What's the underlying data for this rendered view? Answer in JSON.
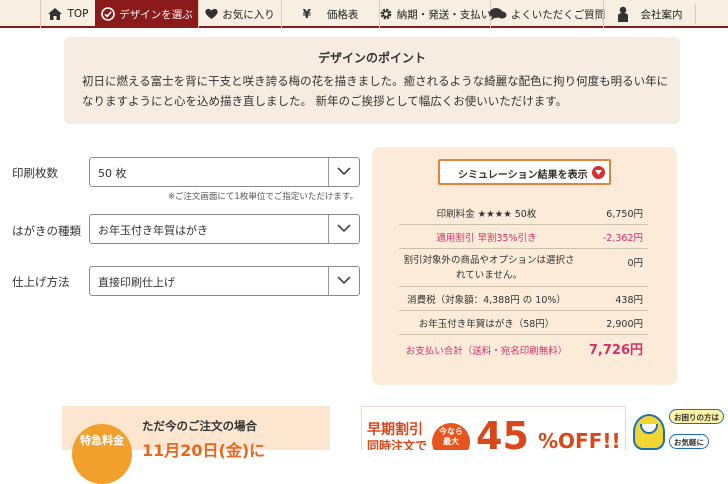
{
  "nav": {
    "items": [
      {
        "label": "TOP",
        "icon": "home-icon",
        "active": false
      },
      {
        "label": "デザインを選ぶ",
        "icon": "check-circle-icon",
        "active": true
      },
      {
        "label": "お気に入り",
        "icon": "heart-icon",
        "active": false
      },
      {
        "label": "価格表",
        "icon": "yen-icon",
        "active": false
      },
      {
        "label": "納期・発送・支払い",
        "icon": "gear-icon",
        "active": false
      },
      {
        "label": "よくいただくご質問",
        "icon": "speech-bubbles-icon",
        "active": false
      },
      {
        "label": "会社案内",
        "icon": "person-icon",
        "active": false
      }
    ],
    "accent_color": "#8b1a1a"
  },
  "design_point": {
    "title": "デザインのポイント",
    "text": "初日に燃える富士を背に干支と咲き誇る梅の花を描きました。癒されるような綺麗な配色に拘り何度も明るい年になりますようにと心を込め描き直しました。 新年のご挨拶として幅広くお使いいただけます。"
  },
  "form": {
    "print_count": {
      "label": "印刷枚数",
      "value": "50 枚"
    },
    "note": "※ご注文画面にて1枚単位でご指定いただけます。",
    "card_type": {
      "label": "はがきの種類",
      "value": "お年玉付き年賀はがき"
    },
    "finish": {
      "label": "仕上げ方法",
      "value": "直接印刷仕上げ"
    }
  },
  "simulation": {
    "button_label": "シミュレーション結果を表示",
    "rows": [
      {
        "label": "印刷料金 ★★★★ 50枚",
        "value": "6,750円"
      },
      {
        "label": "適用割引 早割35%引き",
        "value": "-2,362円"
      },
      {
        "label": "割引対象外の商品やオプションは選択されていません。",
        "value": "0円"
      },
      {
        "label": "消費税（対象額：4,388円 の 10%）",
        "value": "438円"
      },
      {
        "label": "お年玉付き年賀はがき（58円）",
        "value": "2,900円"
      },
      {
        "label": "お支払い合計（送料・宛名印刷無料）",
        "value": "7,726円"
      }
    ],
    "discount_color": "#d4306a"
  },
  "banner_left": {
    "badge": "特急料金",
    "title": "ただ今のご注文の場合",
    "date": "11月20日(金)に"
  },
  "banner_right": {
    "early": "早期割引",
    "sub": "同時注文で",
    "badge_line1": "今なら",
    "badge_line2": "最大",
    "percent": "45",
    "off": "%OFF!!"
  },
  "help": {
    "line1": "お困りの方は",
    "line2": "お気軽に"
  }
}
